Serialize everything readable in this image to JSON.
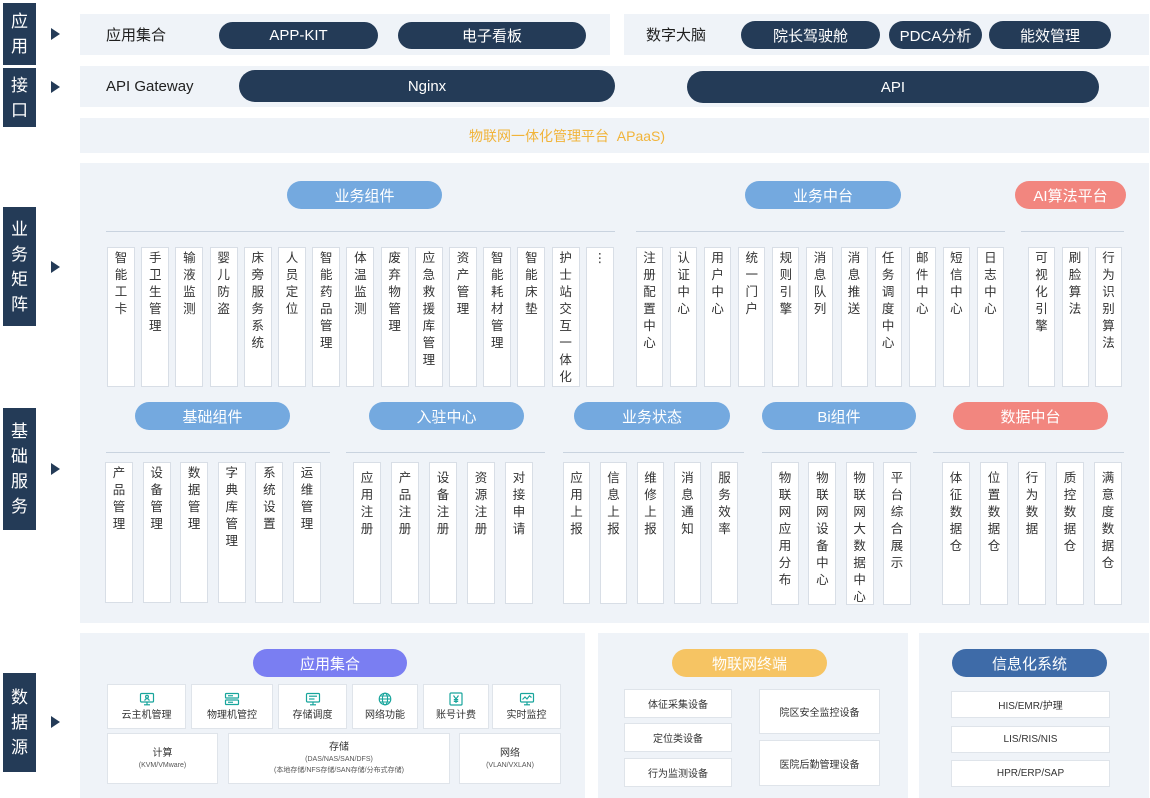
{
  "side_labels": {
    "application": "应用",
    "interface": "接口",
    "business_matrix": "业务矩阵",
    "basic_services": "基础服务",
    "data_source": "数据源"
  },
  "application_layer": {
    "app_collection": {
      "label": "应用集合",
      "items": [
        "APP-KIT",
        "电子看板"
      ]
    },
    "digital_brain": {
      "label": "数字大脑",
      "items": [
        "院长驾驶舱",
        "PDCA分析",
        "能效管理"
      ]
    }
  },
  "interface_layer": {
    "label": "API Gateway",
    "items": [
      "Nginx",
      "API"
    ]
  },
  "platform_banner": "物联网一体化管理平台  APaaS)",
  "business_matrix": {
    "business_components": {
      "title": "业务组件",
      "items": [
        "智能工卡",
        "手卫生管理",
        "输液监测",
        "婴儿防盗",
        "床旁服务系统",
        "人员定位",
        "智能药品管理",
        "体温监测",
        "废弃物管理",
        "应急救援库管理",
        "资产管理",
        "智能耗材管理",
        "智能床垫",
        "护士站交互一体化",
        "⋮"
      ]
    },
    "business_middle_platform": {
      "title": "业务中台",
      "items": [
        "注册配置中心",
        "认证中心",
        "用户中心",
        "统一门户",
        "规则引擎",
        "消息队列",
        "消息推送",
        "任务调度中心",
        "邮件中心",
        "短信中心",
        "日志中心"
      ]
    },
    "ai_algorithm_platform": {
      "title": "AI算法平台",
      "items": [
        "可视化引擎",
        "刷脸算法",
        "行为识别算法"
      ]
    }
  },
  "basic_services": {
    "basic_components": {
      "title": "基础组件",
      "items": [
        "产品管理",
        "设备管理",
        "数据管理",
        "字典库管理",
        "系统设置",
        "运维管理"
      ]
    },
    "onboarding_center": {
      "title": "入驻中心",
      "items": [
        "应用注册",
        "产品注册",
        "设备注册",
        "资源注册",
        "对接申请"
      ]
    },
    "business_status": {
      "title": "业务状态",
      "items": [
        "应用上报",
        "信息上报",
        "维修上报",
        "消息通知",
        "服务效率"
      ]
    },
    "bi_components": {
      "title": "Bi组件",
      "items": [
        "物联网应用分布",
        "物联网设备中心",
        "物联网大数据中心",
        "平台综合展示"
      ]
    },
    "data_middle_platform": {
      "title": "数据中台",
      "items": [
        "体征数据仓",
        "位置数据仓",
        "行为数据",
        "质控数据仓",
        "满意度数据仓"
      ]
    }
  },
  "data_sources": {
    "app_collection": {
      "title": "应用集合",
      "features": [
        {
          "label": "云主机管理",
          "icon": "monitor-icon"
        },
        {
          "label": "物理机管控",
          "icon": "server-icon"
        },
        {
          "label": "存储调度",
          "icon": "storage-screen-icon"
        },
        {
          "label": "网络功能",
          "icon": "globe-icon"
        },
        {
          "label": "账号计费",
          "icon": "yen-icon"
        },
        {
          "label": "实时监控",
          "icon": "monitor-chart-icon"
        }
      ],
      "resources": [
        {
          "title": "计算",
          "details": [
            "(KVM/VMware)"
          ]
        },
        {
          "title": "存储",
          "details": [
            "(DAS/NAS/SAN/DFS)",
            "(本地存储/NFS存储/SAN存储/分布式存储)"
          ]
        },
        {
          "title": "网络",
          "details": [
            "(VLAN/VXLAN)"
          ]
        }
      ]
    },
    "iot_terminals": {
      "title": "物联网终端",
      "left_items": [
        "体征采集设备",
        "定位类设备",
        "行为监测设备"
      ],
      "right_items": [
        "院区安全监控设备",
        "医院后勤管理设备"
      ]
    },
    "information_systems": {
      "title": "信息化系统",
      "items": [
        "HIS/EMR/护理",
        "LIS/RIS/NIS",
        "HPR/ERP/SAP"
      ]
    }
  },
  "colors": {
    "navy": "#243b57",
    "panel": "#eff3f8",
    "blue_pill": "#74a9df",
    "red_pill": "#f2867f",
    "purple_pill": "#7a7ef2",
    "yellow_pill": "#f6c463",
    "info_blue_pill": "#3e6ba8",
    "banner_text": "#f1b43a",
    "icon_teal": "#18a59c"
  }
}
